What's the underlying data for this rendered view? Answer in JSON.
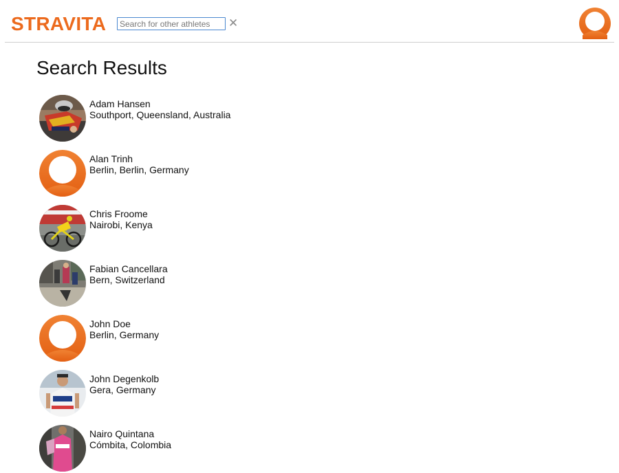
{
  "app": {
    "logo_text": "STRAVITA",
    "brand_color": "#ec6a1d"
  },
  "search": {
    "placeholder": "Search for other athletes",
    "value": "",
    "clear_icon": "close-icon"
  },
  "header": {
    "profile_icon": "user-avatar-icon"
  },
  "page": {
    "title": "Search Results"
  },
  "results": [
    {
      "name": "Adam Hansen",
      "location": "Southport, Queensland, Australia",
      "avatar": "photo"
    },
    {
      "name": "Alan Trinh",
      "location": "Berlin, Berlin, Germany",
      "avatar": "default-user-icon"
    },
    {
      "name": "Chris Froome",
      "location": "Nairobi, Kenya",
      "avatar": "photo"
    },
    {
      "name": "Fabian Cancellara",
      "location": "Bern, Switzerland",
      "avatar": "photo"
    },
    {
      "name": "John Doe",
      "location": "Berlin, Germany",
      "avatar": "default-user-icon"
    },
    {
      "name": "John Degenkolb",
      "location": "Gera, Germany",
      "avatar": "photo"
    },
    {
      "name": "Nairo Quintana",
      "location": "Cómbita, Colombia",
      "avatar": "photo"
    }
  ]
}
